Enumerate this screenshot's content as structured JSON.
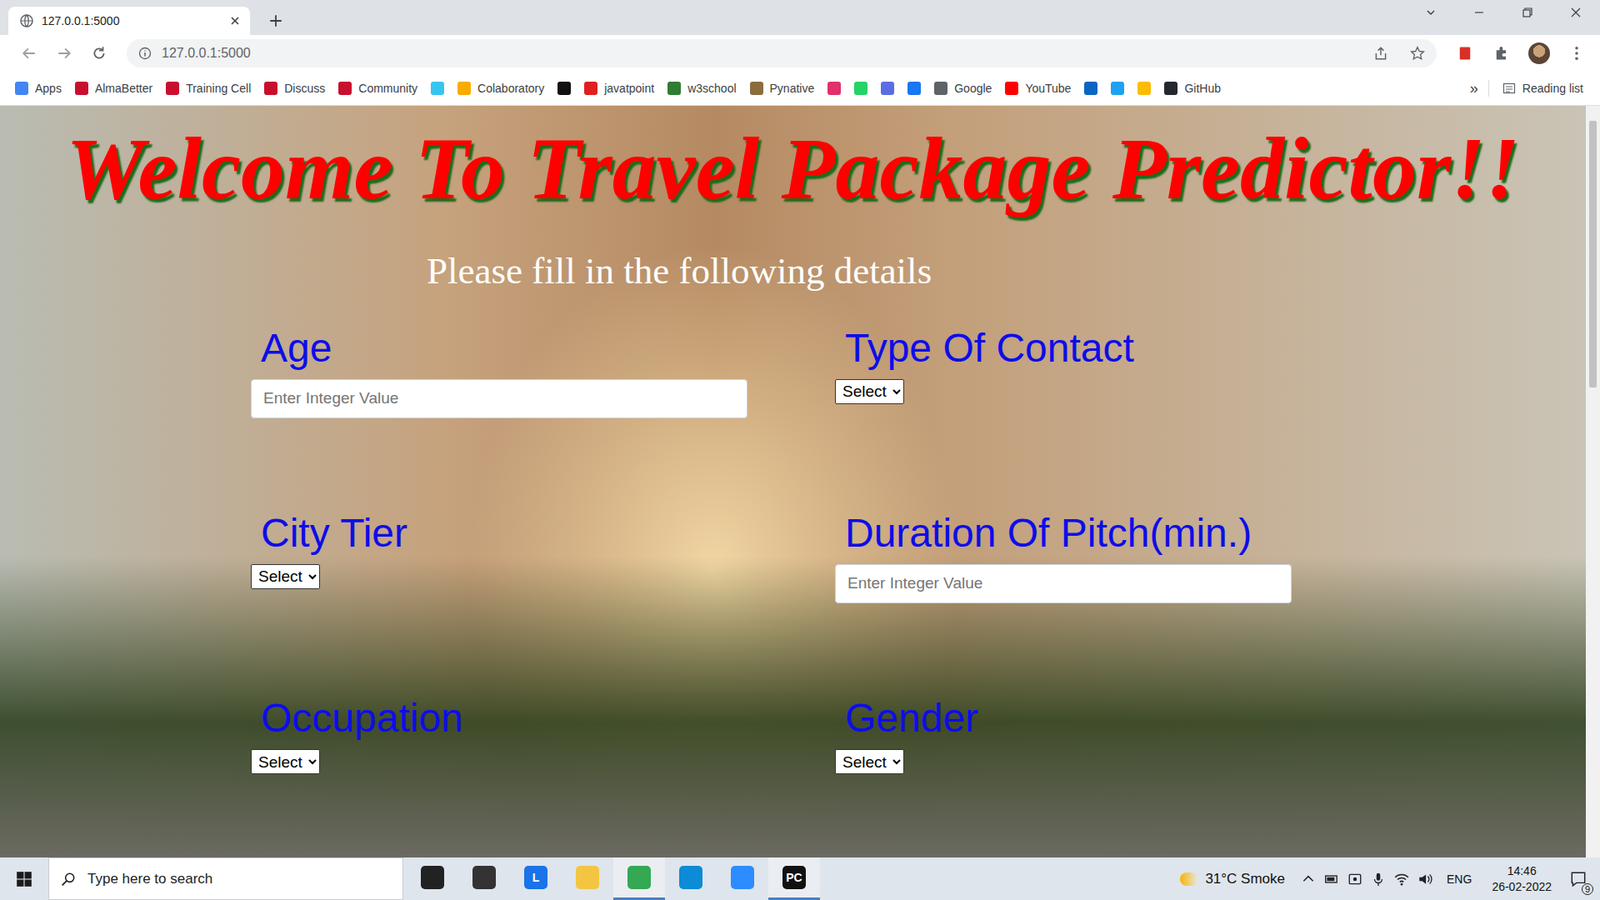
{
  "tab": {
    "title": "127.0.0.1:5000",
    "selected": true
  },
  "address_bar": {
    "url": "127.0.0.1:5000"
  },
  "bookmarks": [
    {
      "label": "Apps",
      "color": "#4285f4"
    },
    {
      "label": "AlmaBetter",
      "color": "#c8102e"
    },
    {
      "label": "Training Cell",
      "color": "#c8102e"
    },
    {
      "label": "Discuss",
      "color": "#c8102e"
    },
    {
      "label": "Community",
      "color": "#c8102e"
    },
    {
      "label": "",
      "color": "#36c5f0"
    },
    {
      "label": "Colaboratory",
      "color": "#f9ab00"
    },
    {
      "label": "",
      "color": "#111111"
    },
    {
      "label": "javatpoint",
      "color": "#e02020"
    },
    {
      "label": "w3school",
      "color": "#2e7d32"
    },
    {
      "label": "Pynative",
      "color": "#8a6d3b"
    },
    {
      "label": "",
      "color": "#e1306c"
    },
    {
      "label": "",
      "color": "#25d366"
    },
    {
      "label": "",
      "color": "#5b6ee1"
    },
    {
      "label": "",
      "color": "#1877f2"
    },
    {
      "label": "Google",
      "color": "#5f6368"
    },
    {
      "label": "YouTube",
      "color": "#ff0000"
    },
    {
      "label": "",
      "color": "#0a66c2"
    },
    {
      "label": "",
      "color": "#1da1f2"
    },
    {
      "label": "",
      "color": "#fbbc04"
    },
    {
      "label": "GitHub",
      "color": "#24292f"
    }
  ],
  "bookmarks_more": "»",
  "reading_list": "Reading list",
  "page": {
    "title": "Welcome To Travel Package Predictor!!",
    "subtitle": "Please fill in the following details",
    "fields": [
      {
        "label": "Age",
        "kind": "input",
        "placeholder": "Enter Integer Value"
      },
      {
        "label": "Type Of Contact",
        "kind": "select",
        "value": "Select"
      },
      {
        "label": "City Tier",
        "kind": "select",
        "value": "Select"
      },
      {
        "label": "Duration Of Pitch(min.)",
        "kind": "input",
        "placeholder": "Enter Integer Value"
      },
      {
        "label": "Occupation",
        "kind": "select",
        "value": "Select"
      },
      {
        "label": "Gender",
        "kind": "select",
        "value": "Select"
      }
    ]
  },
  "taskbar": {
    "search_placeholder": "Type here to search",
    "apps": [
      {
        "glyph": "",
        "color": "#222222",
        "running": false
      },
      {
        "glyph": "",
        "color": "#333333",
        "running": false
      },
      {
        "glyph": "L",
        "color": "#1a73e8",
        "running": false
      },
      {
        "glyph": "",
        "color": "#f4c542",
        "running": false
      },
      {
        "glyph": "",
        "color": "#34a853",
        "running": true
      },
      {
        "glyph": "",
        "color": "#0c8bd6",
        "running": false
      },
      {
        "glyph": "",
        "color": "#2d8cff",
        "running": false
      },
      {
        "glyph": "PC",
        "color": "#111111",
        "running": true
      }
    ],
    "weather": "31°C Smoke",
    "language": "ENG",
    "time": "14:46",
    "date": "26-02-2022",
    "notifications": "9"
  }
}
